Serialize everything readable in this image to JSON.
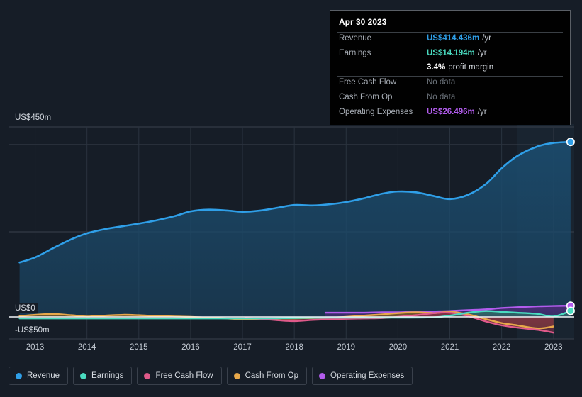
{
  "chart_data": {
    "type": "area",
    "title": "",
    "xlabel": "",
    "ylabel": "",
    "ylim": [
      -50,
      450
    ],
    "xlim": [
      2012.5,
      2023.4
    ],
    "grid": true,
    "currency": "US$",
    "units": "m",
    "y_ticks": [
      {
        "value": 450,
        "label": "US$450m"
      },
      {
        "value": 0,
        "label": "US$0"
      },
      {
        "value": -50,
        "label": "-US$50m"
      }
    ],
    "x_ticks": [
      {
        "value": 2013,
        "label": "2013"
      },
      {
        "value": 2014,
        "label": "2014"
      },
      {
        "value": 2015,
        "label": "2015"
      },
      {
        "value": 2016,
        "label": "2016"
      },
      {
        "value": 2017,
        "label": "2017"
      },
      {
        "value": 2018,
        "label": "2018"
      },
      {
        "value": 2019,
        "label": "2019"
      },
      {
        "value": 2020,
        "label": "2020"
      },
      {
        "value": 2021,
        "label": "2021"
      },
      {
        "value": 2022,
        "label": "2022"
      },
      {
        "value": 2023,
        "label": "2023"
      }
    ],
    "forecast_start": 2022.3,
    "series": [
      {
        "name": "Revenue",
        "color": "#2f9fe8",
        "fill": "#1b4a6b",
        "x": [
          2012.7,
          2013.0,
          2013.35,
          2013.7,
          2014.0,
          2014.35,
          2014.7,
          2015.0,
          2015.35,
          2015.7,
          2016.0,
          2016.35,
          2016.7,
          2017.0,
          2017.35,
          2017.7,
          2018.0,
          2018.35,
          2018.7,
          2019.0,
          2019.35,
          2019.7,
          2020.0,
          2020.35,
          2020.7,
          2021.0,
          2021.35,
          2021.7,
          2022.0,
          2022.3,
          2022.7,
          2023.0,
          2023.33
        ],
        "values": [
          129,
          141,
          163,
          184,
          198,
          208,
          215,
          221,
          229,
          239,
          250,
          254,
          252,
          249,
          252,
          259,
          265,
          264,
          267,
          272,
          281,
          292,
          297,
          295,
          286,
          279,
          289,
          315,
          352,
          381,
          404,
          412,
          414.436
        ]
      },
      {
        "name": "Earnings",
        "color": "#4adbc0",
        "fill": "#2a6e66",
        "x": [
          2012.7,
          2013.35,
          2014.0,
          2014.7,
          2015.35,
          2016.0,
          2016.7,
          2017.35,
          2018.0,
          2018.7,
          2019.35,
          2020.0,
          2020.7,
          2021.0,
          2021.35,
          2021.7,
          2022.0,
          2022.3,
          2022.7,
          2023.0,
          2023.33
        ],
        "values": [
          -4,
          -4,
          -4,
          -4,
          -4,
          -4,
          -4,
          -4,
          -3,
          -2,
          -2,
          -2,
          -1,
          3,
          10,
          14,
          12,
          10,
          7,
          1,
          14.194
        ]
      },
      {
        "name": "Free Cash Flow",
        "color": "#e05a8a",
        "fill": "#7d2d46",
        "x": [
          2017.05,
          2017.35,
          2017.7,
          2018.0,
          2018.35,
          2018.7,
          2019.0,
          2019.35,
          2019.7,
          2020.0,
          2020.35,
          2020.7,
          2021.0,
          2021.35,
          2021.7,
          2022.0,
          2022.3,
          2022.7,
          2023.0
        ],
        "values": [
          -3,
          -5,
          -9,
          -11,
          -8,
          -6,
          -5,
          -4,
          -3,
          0,
          4,
          9,
          10,
          2,
          -12,
          -22,
          -28,
          -34,
          -41
        ]
      },
      {
        "name": "Cash From Op",
        "color": "#e8a84a",
        "fill": "#7a5a26",
        "x": [
          2012.7,
          2013.0,
          2013.35,
          2013.7,
          2014.0,
          2014.35,
          2014.7,
          2015.0,
          2015.35,
          2015.7,
          2016.0,
          2016.35,
          2016.7,
          2017.0,
          2017.35,
          2017.7,
          2018.0,
          2018.35,
          2018.7,
          2019.0,
          2019.35,
          2019.7,
          2020.0,
          2020.35,
          2020.7,
          2021.0,
          2021.35,
          2021.7,
          2022.0,
          2022.3,
          2022.7,
          2023.0
        ],
        "values": [
          2,
          5,
          7,
          4,
          1,
          3,
          5,
          4,
          2,
          1,
          0,
          -2,
          -4,
          -6,
          -5,
          -4,
          -4,
          -3,
          -2,
          0,
          3,
          6,
          9,
          11,
          9,
          12,
          6,
          -6,
          -16,
          -22,
          -30,
          -25
        ]
      },
      {
        "name": "Operating Expenses",
        "color": "#b25ced",
        "fill": "#4c2a77",
        "x": [
          2018.6,
          2019.0,
          2019.35,
          2019.7,
          2020.0,
          2020.35,
          2020.7,
          2021.0,
          2021.35,
          2021.7,
          2022.0,
          2022.3,
          2022.7,
          2023.0,
          2023.33
        ],
        "values": [
          10,
          10,
          10,
          11,
          11,
          12,
          13,
          14,
          16,
          18,
          21,
          23,
          25,
          26,
          26.496
        ]
      }
    ],
    "end_markers": [
      {
        "series": "Revenue",
        "x": 2023.33,
        "value": 414.436,
        "color": "#2f9fe8"
      },
      {
        "series": "Operating Expenses",
        "x": 2023.33,
        "value": 26.496,
        "color": "#b25ced"
      },
      {
        "series": "Earnings",
        "x": 2023.33,
        "value": 14.194,
        "color": "#4adbc0"
      }
    ]
  },
  "tooltip": {
    "date": "Apr 30 2023",
    "rows": [
      {
        "key": "Revenue",
        "value": "US$414.436m",
        "unit": "/yr",
        "style": "revenue"
      },
      {
        "key": "Earnings",
        "value": "US$14.194m",
        "unit": "/yr",
        "style": "earnings"
      },
      {
        "key": "",
        "value": "3.4%",
        "unit": "profit margin",
        "style": "margin"
      },
      {
        "key": "Free Cash Flow",
        "value": "No data",
        "unit": "",
        "style": "nodata"
      },
      {
        "key": "Cash From Op",
        "value": "No data",
        "unit": "",
        "style": "nodata"
      },
      {
        "key": "Operating Expenses",
        "value": "US$26.496m",
        "unit": "/yr",
        "style": "opex"
      }
    ]
  },
  "legend": {
    "items": [
      {
        "label": "Revenue",
        "color": "#2f9fe8"
      },
      {
        "label": "Earnings",
        "color": "#4adbc0"
      },
      {
        "label": "Free Cash Flow",
        "color": "#e05a8a"
      },
      {
        "label": "Cash From Op",
        "color": "#e8a84a"
      },
      {
        "label": "Operating Expenses",
        "color": "#b25ced"
      }
    ]
  }
}
